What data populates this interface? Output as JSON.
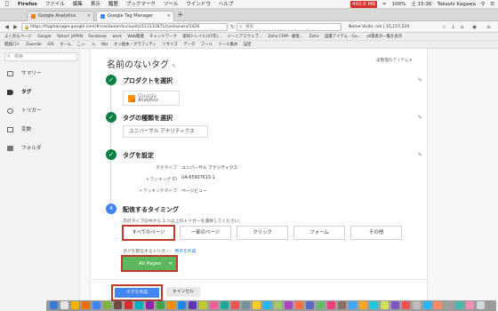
{
  "menubar": {
    "apple": "",
    "items": [
      "Firefox",
      "ファイル",
      "編集",
      "表示",
      "履歴",
      "ブックマーク",
      "ツール",
      "ウインドウ",
      "ヘルプ"
    ],
    "memory": "450.0 MB",
    "battery": "100%",
    "time": "土 15:36",
    "user": "Takashi Kagawa"
  },
  "tabs": [
    {
      "title": "Google Analytics",
      "favicon_color": "#f57c00"
    },
    {
      "title": "Google Tag Manager",
      "favicon_color": "#4285f4"
    }
  ],
  "address": {
    "url": "https://tagmanager.google.com/#/container/accounts/113131871/containers/1426",
    "search_placeholder": "検索",
    "account_info": "Nome  Visits: n/a  | 15,157,220"
  },
  "bookmarks_row1": [
    "よく見るページ",
    "Google",
    "Yahoo! JAPAN",
    "Facebook",
    "work",
    "Web関連",
    "チャットワーク",
    "愛知トレイル(47年)...",
    "ジーニアスウェブ...",
    "Zoho CRM - 顧客...",
    "Zoho",
    "図書アイテム - Go...",
    "all業者の一覧を表示"
  ],
  "bookmarks_row2": [
    "開発ロト",
    "Zoomile",
    "iOS",
    "ホーム",
    "こっ-",
    "入",
    "Wiz",
    "オン絵本・グラフィティ",
    "リサイズ",
    "データ",
    "フール",
    "ツール集め",
    "設定"
  ],
  "sidebar": {
    "search_placeholder": "検索",
    "items": [
      {
        "label": "サマリー",
        "icon": "summary-icon"
      },
      {
        "label": "タグ",
        "icon": "tag-icon",
        "active": true
      },
      {
        "label": "トリガー",
        "icon": "trigger-icon"
      },
      {
        "label": "変数",
        "icon": "variable-icon"
      },
      {
        "label": "フォルダ",
        "icon": "folder-icon"
      }
    ]
  },
  "tag": {
    "title": "名前のないタグ",
    "unsaved_label": "未整理のアイテム",
    "steps": [
      {
        "label": "プロダクトを選択",
        "done": true
      },
      {
        "label": "タグの種類を選択",
        "done": true
      },
      {
        "label": "タグを設定",
        "done": true
      },
      {
        "label": "配信するタイミング",
        "number": "4"
      }
    ],
    "product": {
      "name": "Google",
      "sub": "Analytics"
    },
    "tag_type": "ユニバーサル アナリティクス",
    "config": [
      {
        "key": "タグタイプ",
        "value": "ユニバーサル アナリティクス"
      },
      {
        "key": "トラッキング ID",
        "value": "UA-65907613-1"
      },
      {
        "key": "トラッキングタイプ",
        "value": "ページビュー"
      }
    ],
    "trigger_desc": "次のタイプの中から 1 つ以上のトリガーを選択してください。",
    "trigger_buttons": [
      "すべてのページ",
      "一部のページ",
      "クリック",
      "フォーム",
      "その他"
    ],
    "fire_label": "タグを配信するトリガー:",
    "fire_link": "例外を作成",
    "selected_trigger": "All Pages",
    "create_button": "タグを作成",
    "cancel_button": "キャンセル"
  },
  "colors": {
    "accent": "#4285f4",
    "done": "#0b8043",
    "chip": "#5cb85c",
    "highlight": "#c53929"
  }
}
